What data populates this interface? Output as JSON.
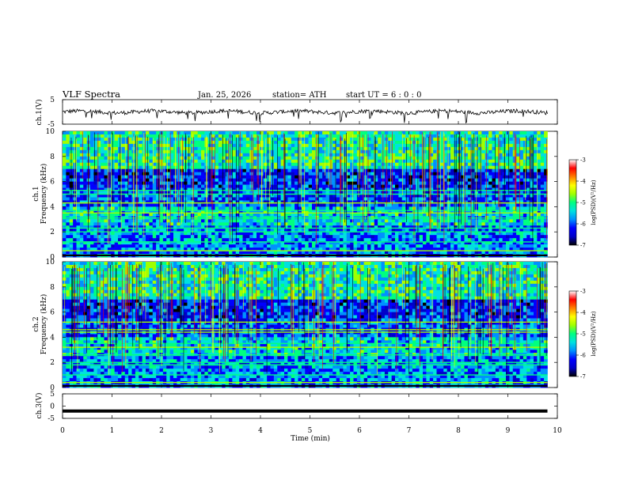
{
  "header": {
    "title": "VLF  Spectra",
    "date": "Jan. 25, 2026",
    "station": "station= ATH",
    "start": "start  UT  =    6  : 0  : 0"
  },
  "chart_data": [
    {
      "type": "line",
      "panel": "ch1-waveform",
      "ylabel": "ch.1(V)",
      "ylim": [
        -5,
        5
      ],
      "yticks": [
        "5",
        "-5"
      ],
      "baseline": 0,
      "x_range": [
        0,
        9.8
      ],
      "grid": false
    },
    {
      "type": "heatmap",
      "panel": "ch1-spectrogram",
      "ylabel_top": "ch.1",
      "ylabel": "Frequency  (kHz)",
      "ylim": [
        0,
        10
      ],
      "yticks": [
        "0",
        "2",
        "4",
        "6",
        "8",
        "10"
      ],
      "x_range": [
        0,
        9.8
      ],
      "colorbar": {
        "label": "log(PSD)(V²/Hz)",
        "range": [
          -7,
          -3
        ],
        "ticks": [
          "-3",
          "-4",
          "-5",
          "-6",
          "-7"
        ],
        "colors": [
          "#000000",
          "#0000c8",
          "#0000ff",
          "#0090ff",
          "#00e0e0",
          "#00ff80",
          "#a0ff00",
          "#ffff00",
          "#ff8000",
          "#ff0000",
          "#ffffff"
        ]
      },
      "bands_khz": [
        0.5,
        1.2,
        2.0,
        2.3,
        3.1,
        3.5,
        3.7,
        4.3,
        5.0,
        5.3
      ]
    },
    {
      "type": "heatmap",
      "panel": "ch2-spectrogram",
      "ylabel_top": "ch.2",
      "ylabel": "Frequency  (kHz)",
      "ylim": [
        0,
        10
      ],
      "yticks": [
        "0",
        "2",
        "4",
        "6",
        "8",
        "10"
      ],
      "x_range": [
        0,
        9.8
      ],
      "colorbar": {
        "label": "log(PSD)(V²/Hz)",
        "range": [
          -7,
          -3
        ],
        "ticks": [
          "-3",
          "-4",
          "-5",
          "-6",
          "-7"
        ],
        "colors": [
          "#000000",
          "#0000c8",
          "#0000ff",
          "#0090ff",
          "#00e0e0",
          "#00ff80",
          "#a0ff00",
          "#ffff00",
          "#ff8000",
          "#ff0000",
          "#ffffff"
        ]
      },
      "bands_khz": [
        0.4,
        1.0,
        1.8,
        2.0,
        2.6,
        3.2,
        3.5,
        4.4,
        4.6,
        5.2
      ]
    },
    {
      "type": "line",
      "panel": "ch3-waveform",
      "ylabel": "ch.3(V)",
      "ylim": [
        -5,
        5
      ],
      "yticks": [
        "5",
        "0",
        "-5"
      ],
      "baseline": -2,
      "x_range": [
        0,
        9.8
      ],
      "xlabel": "Time  (min)",
      "xlim": [
        0,
        10
      ],
      "xticks": [
        "0",
        "1",
        "2",
        "3",
        "4",
        "5",
        "6",
        "7",
        "8",
        "9",
        "10"
      ],
      "grid": false
    }
  ]
}
